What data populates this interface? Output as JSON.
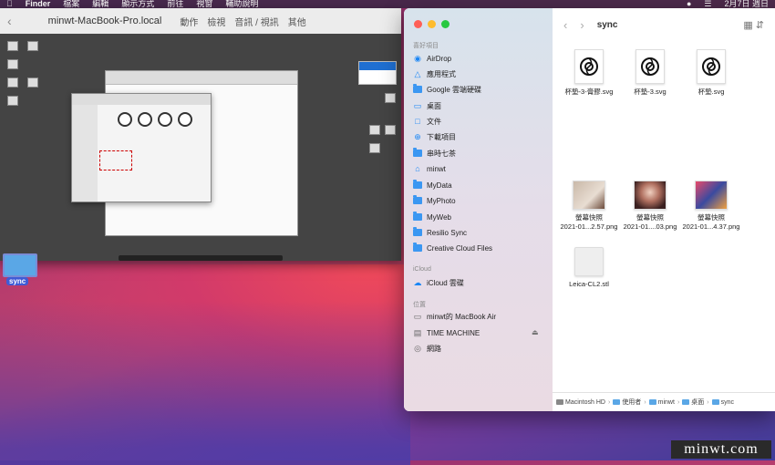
{
  "menubar": {
    "app": "Finder",
    "items": [
      "檔案",
      "編輯",
      "顯示方式",
      "前往",
      "視窗",
      "輔助說明"
    ],
    "date": "2月7日 週日"
  },
  "remote": {
    "title": "minwt-MacBook-Pro.local",
    "toolbar": [
      "動作",
      "檢視",
      "音訊 / 視訊",
      "其他"
    ]
  },
  "desktop": {
    "folder_label": "sync"
  },
  "finder": {
    "title": "sync",
    "sections": {
      "favorites": "喜好項目",
      "icloud": "iCloud",
      "locations": "位置"
    },
    "favorites": [
      {
        "label": "AirDrop",
        "icon": "airdrop-icon"
      },
      {
        "label": "應用程式",
        "icon": "applications-icon"
      },
      {
        "label": "Google 雲端硬碟",
        "icon": "folder-icon"
      },
      {
        "label": "桌面",
        "icon": "desktop-icon"
      },
      {
        "label": "文件",
        "icon": "document-icon"
      },
      {
        "label": "下載項目",
        "icon": "download-icon"
      },
      {
        "label": "串時七茶",
        "icon": "folder-icon"
      },
      {
        "label": "minwt",
        "icon": "home-icon"
      },
      {
        "label": "MyData",
        "icon": "folder-icon"
      },
      {
        "label": "MyPhoto",
        "icon": "folder-icon"
      },
      {
        "label": "MyWeb",
        "icon": "folder-icon"
      },
      {
        "label": "Resilio Sync",
        "icon": "folder-icon"
      },
      {
        "label": "Creative Cloud Files",
        "icon": "folder-icon"
      }
    ],
    "icloud_items": [
      {
        "label": "iCloud 雲碟",
        "icon": "cloud-icon"
      }
    ],
    "locations": [
      {
        "label": "minwt的 MacBook Air",
        "icon": "laptop-icon"
      },
      {
        "label": "TIME MACHINE",
        "icon": "disk-icon"
      },
      {
        "label": "網路",
        "icon": "network-icon"
      }
    ],
    "files": [
      {
        "name": "杯墊-3-膏膠.svg",
        "type": "svg"
      },
      {
        "name": "杯墊-3.svg",
        "type": "svg"
      },
      {
        "name": "杯墊.svg",
        "type": "svg"
      },
      {
        "name": "螢幕快照\n2021-01...2.57.png",
        "line1": "螢幕快照",
        "line2": "2021-01...2.57.png",
        "type": "png-cup"
      },
      {
        "name": "螢幕快照\n2021-01....03.png",
        "line1": "螢幕快照",
        "line2": "2021-01....03.png",
        "type": "png-woman"
      },
      {
        "name": "螢幕快照\n2021-01...4.37.png",
        "line1": "螢幕快照",
        "line2": "2021-01...4.37.png",
        "type": "png-horse"
      },
      {
        "name": "Leica-CL2.stl",
        "type": "stl"
      }
    ],
    "path": [
      "Macintosh HD",
      "使用者",
      "minwt",
      "桌面",
      "sync"
    ]
  },
  "watermark": "minwt.com",
  "colors": {
    "accent": "#1a86f5",
    "folder": "#3b97f2"
  }
}
